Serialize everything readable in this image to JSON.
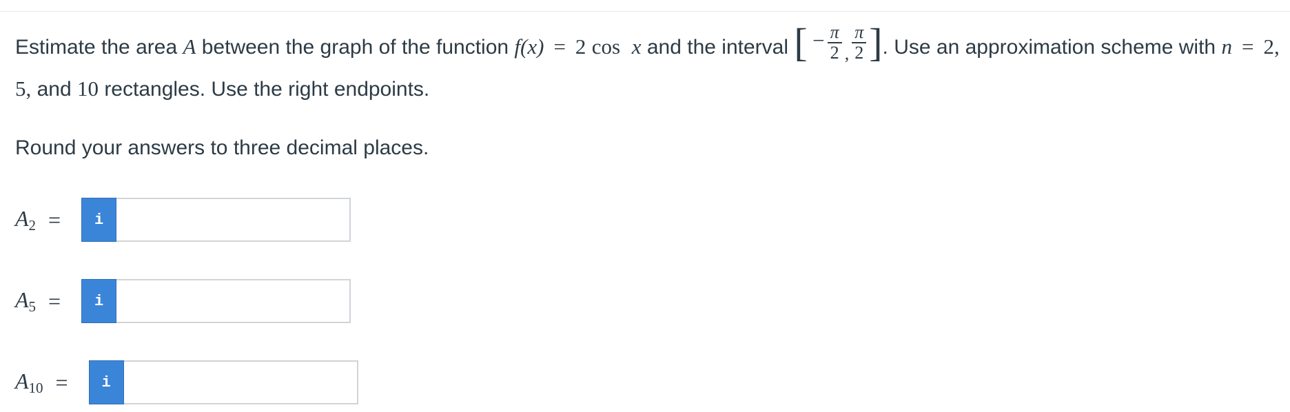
{
  "question": {
    "t1": "Estimate the area ",
    "var_a": "A",
    "t2": " between the graph of the function ",
    "fx": "f(x)",
    "eq": "=",
    "func_coef": "2",
    "func_cos": "cos",
    "func_x": "x",
    "t3": " and the interval ",
    "left_bracket": "[",
    "minus": "−",
    "pi": "π",
    "two": "2",
    "comma": ",",
    "right_bracket": "]",
    "t4": ". Use an approximation scheme with ",
    "n": "n",
    "n_values": "2, 5,",
    "t5": " and ",
    "n_last": "10",
    "t6": " rectangles. Use the right endpoints."
  },
  "instruction": "Round your answers to three decimal places.",
  "answers": [
    {
      "var": "A",
      "sub": "2",
      "eq": "=",
      "info": "i",
      "value": ""
    },
    {
      "var": "A",
      "sub": "5",
      "eq": "=",
      "info": "i",
      "value": ""
    },
    {
      "var": "A",
      "sub": "10",
      "eq": "=",
      "info": "i",
      "value": ""
    }
  ]
}
